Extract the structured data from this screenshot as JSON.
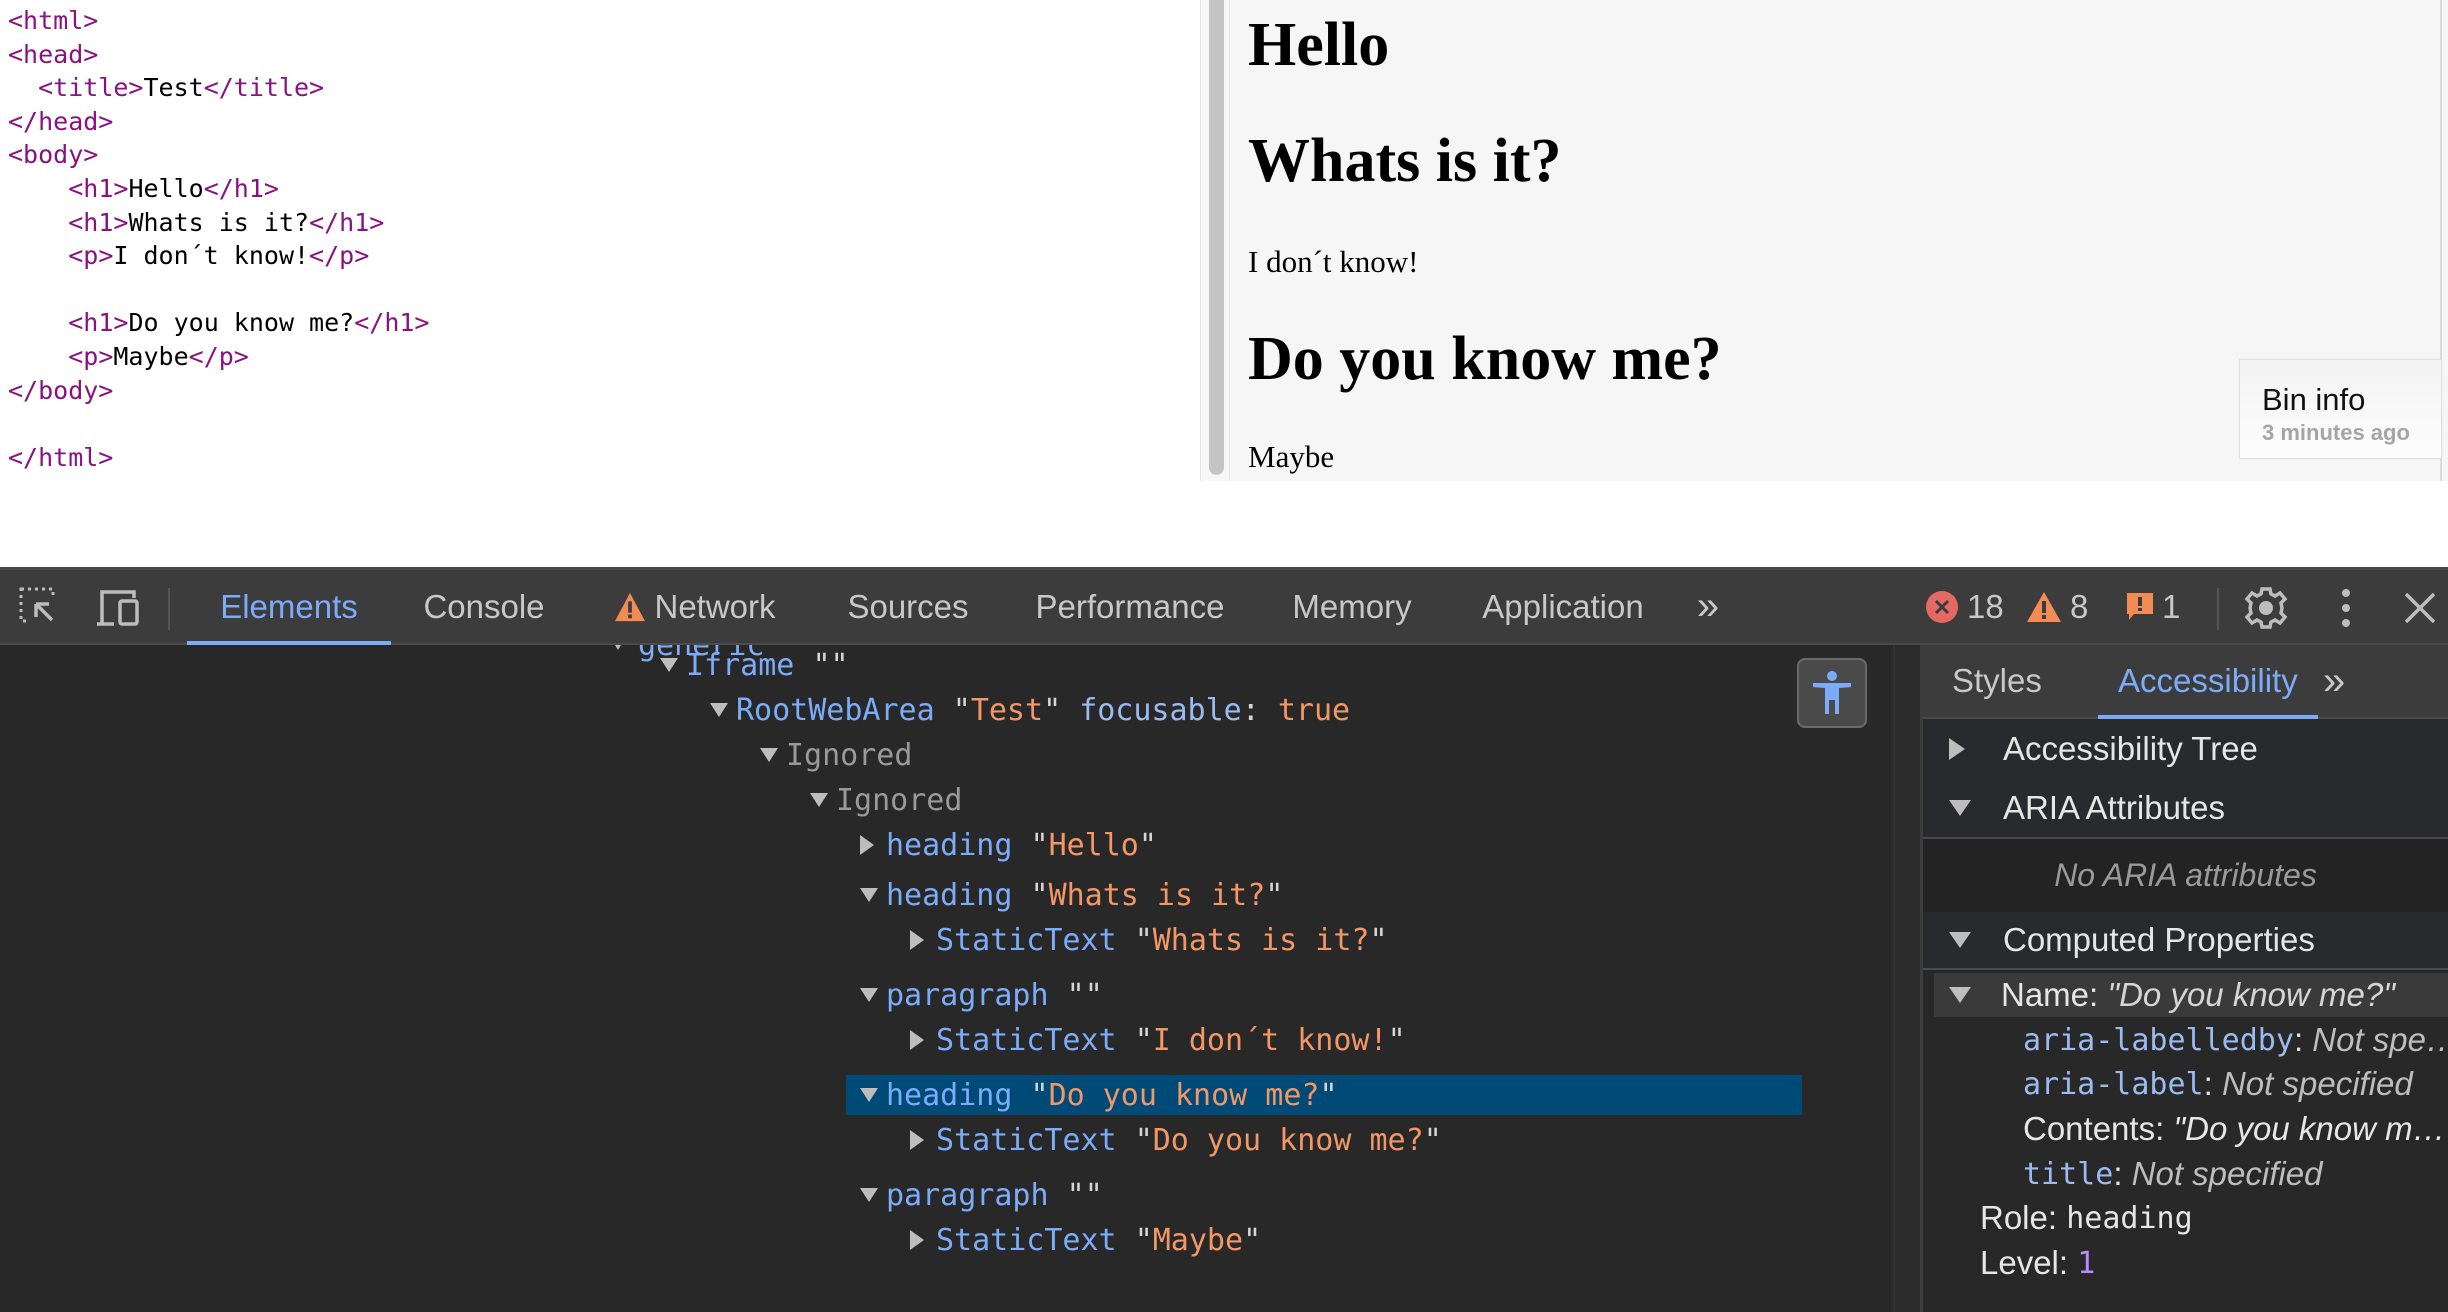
{
  "editor": {
    "lines": [
      [
        {
          "t": "tag",
          "v": "<html>"
        }
      ],
      [
        {
          "t": "tag",
          "v": "<head>"
        }
      ],
      [
        {
          "t": "txt",
          "v": "  "
        },
        {
          "t": "tag",
          "v": "<title>"
        },
        {
          "t": "txt",
          "v": "Test"
        },
        {
          "t": "tag",
          "v": "</title>"
        }
      ],
      [
        {
          "t": "tag",
          "v": "</head>"
        }
      ],
      [
        {
          "t": "tag",
          "v": "<body>"
        }
      ],
      [
        {
          "t": "txt",
          "v": "    "
        },
        {
          "t": "tag",
          "v": "<h1>"
        },
        {
          "t": "txt",
          "v": "Hello"
        },
        {
          "t": "tag",
          "v": "</h1>"
        }
      ],
      [
        {
          "t": "txt",
          "v": "    "
        },
        {
          "t": "tag",
          "v": "<h1>"
        },
        {
          "t": "txt",
          "v": "Whats is it?"
        },
        {
          "t": "tag",
          "v": "</h1>"
        }
      ],
      [
        {
          "t": "txt",
          "v": "    "
        },
        {
          "t": "tag",
          "v": "<p>"
        },
        {
          "t": "txt",
          "v": "I don´t know!"
        },
        {
          "t": "tag",
          "v": "</p>"
        }
      ],
      [],
      [
        {
          "t": "txt",
          "v": "    "
        },
        {
          "t": "tag",
          "v": "<h1>"
        },
        {
          "t": "txt",
          "v": "Do you know me?"
        },
        {
          "t": "tag",
          "v": "</h1>"
        }
      ],
      [
        {
          "t": "txt",
          "v": "    "
        },
        {
          "t": "tag",
          "v": "<p>"
        },
        {
          "t": "txt",
          "v": "Maybe"
        },
        {
          "t": "tag",
          "v": "</p>"
        }
      ],
      [
        {
          "t": "tag",
          "v": "</body>"
        }
      ],
      [],
      [
        {
          "t": "tag",
          "v": "</html>"
        }
      ]
    ]
  },
  "preview": {
    "heading1": "Hello",
    "heading2": "Whats is it?",
    "paragraph1": "I don´t know!",
    "heading3": "Do you know me?",
    "paragraph2": "Maybe",
    "bin_info": {
      "title": "Bin info",
      "time": "3 minutes ago"
    }
  },
  "devtools": {
    "toolbar": {
      "inspect_icon": "inspect-element-icon",
      "device_icon": "device-toolbar-icon",
      "tabs": [
        {
          "label": "Elements",
          "active": true
        },
        {
          "label": "Console"
        },
        {
          "label": "Network",
          "warning": true
        },
        {
          "label": "Sources"
        },
        {
          "label": "Performance"
        },
        {
          "label": "Memory"
        },
        {
          "label": "Application"
        }
      ],
      "more_tabs": "»",
      "errors": "18",
      "warnings": "8",
      "issues": "1",
      "colors": {
        "error": "#e46962",
        "warning": "#f28b54",
        "accent": "#7cacf8"
      }
    },
    "tree": {
      "partial_top": "generic",
      "nodes": [
        {
          "role": "Iframe",
          "name": "",
          "expanded": true
        },
        {
          "role": "RootWebArea",
          "name": "Test",
          "expanded": true,
          "attr": "focusable",
          "attr_value": "true"
        },
        {
          "role": "Ignored",
          "expanded": true,
          "ignored": true
        },
        {
          "role": "Ignored",
          "expanded": true,
          "ignored": true
        },
        {
          "role": "heading",
          "name": "Hello",
          "expanded": false
        },
        {
          "role": "heading",
          "name": "Whats is it?",
          "expanded": true
        },
        {
          "role": "StaticText",
          "name": "Whats is it?",
          "expanded": false
        },
        {
          "role": "paragraph",
          "name": "",
          "expanded": true
        },
        {
          "role": "StaticText",
          "name": "I don´t know!",
          "expanded": false
        },
        {
          "role": "heading",
          "name": "Do you know me?",
          "expanded": true,
          "selected": true
        },
        {
          "role": "StaticText",
          "name": "Do you know me?",
          "expanded": false
        },
        {
          "role": "paragraph",
          "name": "",
          "expanded": true
        },
        {
          "role": "StaticText",
          "name": "Maybe",
          "expanded": false
        }
      ]
    },
    "side": {
      "tabs": [
        {
          "label": "Styles"
        },
        {
          "label": "Accessibility",
          "active": true
        }
      ],
      "more_tabs": "»",
      "sections": {
        "tree": "Accessibility Tree",
        "aria": "ARIA Attributes",
        "no_aria": "No ARIA attributes",
        "computed": "Computed Properties"
      },
      "computed": {
        "name_label": "Name:",
        "name_value": "\"Do you know me?\"",
        "sources": [
          {
            "key": "aria-labelledby",
            "value": "Not spe…"
          },
          {
            "key": "aria-label",
            "value": "Not specified"
          },
          {
            "label": "Contents:",
            "value": "\"Do you know m…"
          },
          {
            "key": "title",
            "value": "Not specified"
          }
        ],
        "role_label": "Role:",
        "role_value": "heading",
        "level_label": "Level:",
        "level_value": "1"
      }
    }
  }
}
